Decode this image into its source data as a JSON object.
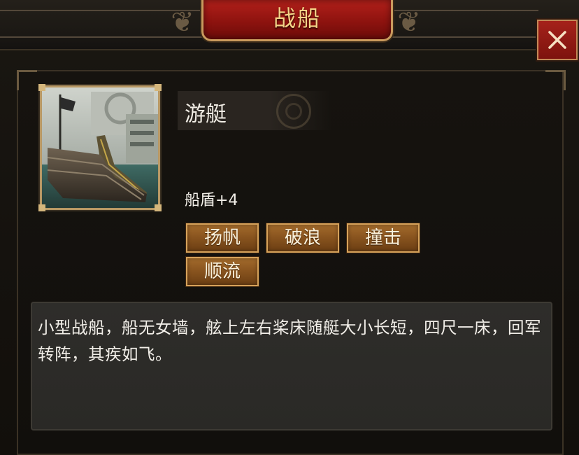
{
  "dialog": {
    "title": "战船",
    "close_label": "✕"
  },
  "ship": {
    "name": "游艇",
    "stat": "船盾+4",
    "skills": [
      "扬帆",
      "破浪",
      "撞击",
      "顺流"
    ],
    "description": "小型战船，船无女墙，舷上左右桨床随艇大小长短，四尺一床，回军转阵，其疾如飞。"
  },
  "colors": {
    "title_plate": "#8e130f",
    "title_text": "#f3d488",
    "skill_button": "#8a551f",
    "frame_gold": "#b89864"
  },
  "icons": {
    "close": "close-icon",
    "portrait": "ship-portrait-image"
  }
}
